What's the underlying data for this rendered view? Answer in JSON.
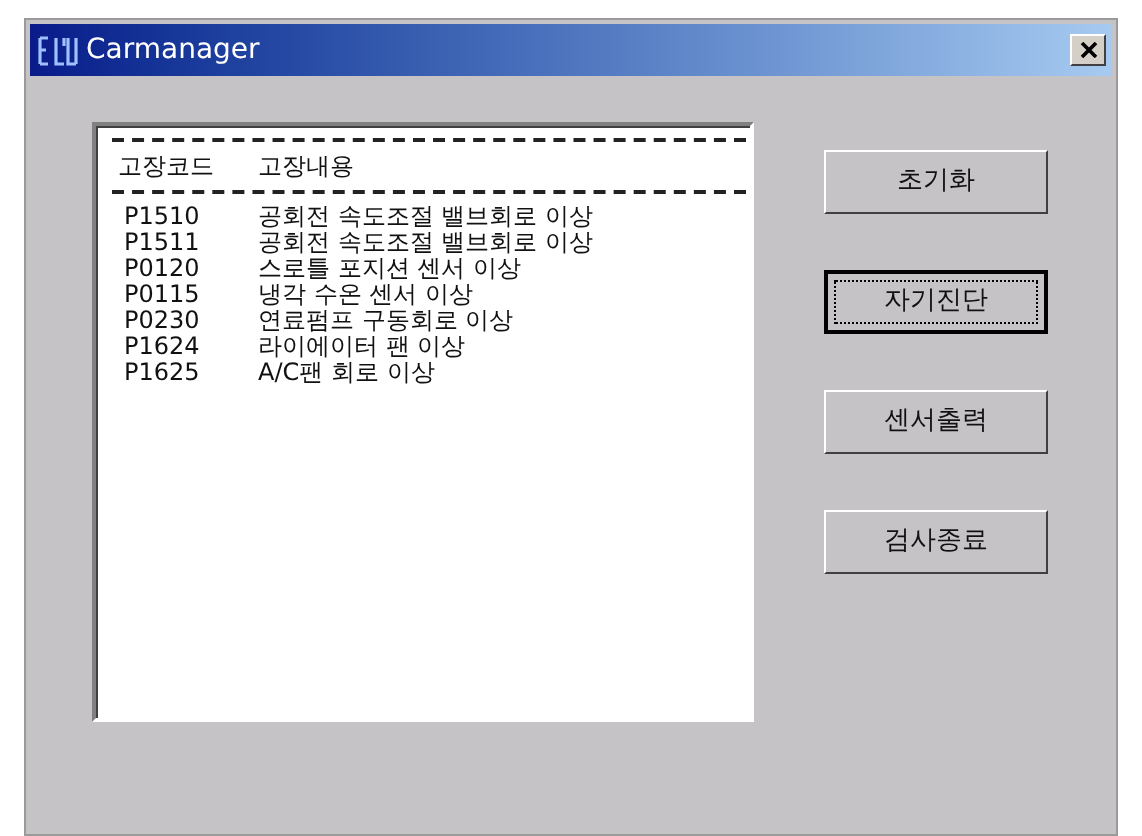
{
  "window": {
    "title": "Carmanager"
  },
  "list": {
    "columns": [
      "고장코드",
      "고장내용"
    ],
    "rows": [
      {
        "code": "P1510",
        "description": "공회전 속도조절 밸브회로 이상"
      },
      {
        "code": "P1511",
        "description": "공회전 속도조절 밸브회로 이상"
      },
      {
        "code": "P0120",
        "description": "스로틀 포지션 센서 이상"
      },
      {
        "code": "P0115",
        "description": "냉각 수온 센서 이상"
      },
      {
        "code": "P0230",
        "description": "연료펌프 구동회로 이상"
      },
      {
        "code": "P1624",
        "description": "라이에이터 팬 이상"
      },
      {
        "code": "P1625",
        "description": "A/C팬 회로 이상"
      }
    ]
  },
  "buttons": [
    {
      "label": "초기화",
      "focused": false
    },
    {
      "label": "자기진단",
      "focused": true
    },
    {
      "label": "센서출력",
      "focused": false
    },
    {
      "label": "검사종료",
      "focused": false
    }
  ]
}
